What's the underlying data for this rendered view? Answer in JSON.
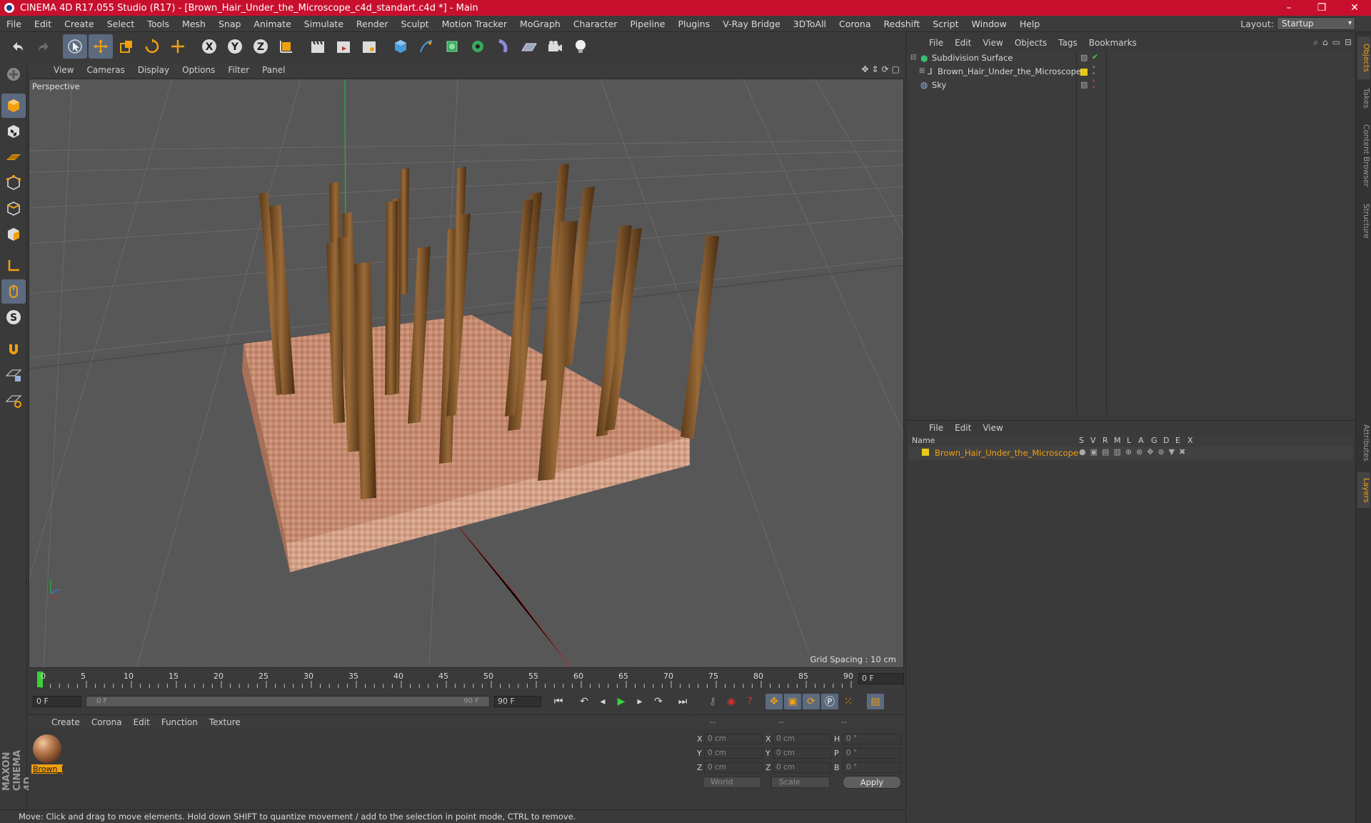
{
  "window": {
    "title": "CINEMA 4D R17.055 Studio (R17) - [Brown_Hair_Under_the_Microscope_c4d_standart.c4d *] - Main",
    "minimize": "–",
    "maximize": "❐",
    "close": "✕"
  },
  "menu": {
    "items": [
      "File",
      "Edit",
      "Create",
      "Select",
      "Tools",
      "Mesh",
      "Snap",
      "Animate",
      "Simulate",
      "Render",
      "Sculpt",
      "Motion Tracker",
      "MoGraph",
      "Character",
      "Pipeline",
      "Plugins",
      "V-Ray Bridge",
      "3DToAll",
      "Corona",
      "Redshift",
      "Script",
      "Window",
      "Help"
    ],
    "layout_label": "Layout:",
    "layout_value": "Startup"
  },
  "viewport": {
    "menu": [
      "View",
      "Cameras",
      "Display",
      "Options",
      "Filter",
      "Panel"
    ],
    "label": "Perspective",
    "grid_spacing": "Grid Spacing : 10 cm"
  },
  "timeline": {
    "ticks": [
      "0",
      "5",
      "10",
      "15",
      "20",
      "25",
      "30",
      "35",
      "40",
      "45",
      "50",
      "55",
      "60",
      "65",
      "70",
      "75",
      "80",
      "85",
      "90"
    ],
    "current_frame": "0 F",
    "start_field": "0 F",
    "slider_start": "0 F",
    "slider_end": "90 F",
    "end_field": "90 F"
  },
  "material_manager": {
    "menu": [
      "Create",
      "Corona",
      "Edit",
      "Function",
      "Texture"
    ],
    "material_name": "Brown_I"
  },
  "coordinates": {
    "header": [
      "--",
      "--",
      "--"
    ],
    "rows": [
      {
        "l1": "X",
        "v1": "0 cm",
        "l2": "X",
        "v2": "0 cm",
        "l3": "H",
        "v3": "0 °"
      },
      {
        "l1": "Y",
        "v1": "0 cm",
        "l2": "Y",
        "v2": "0 cm",
        "l3": "P",
        "v3": "0 °"
      },
      {
        "l1": "Z",
        "v1": "0 cm",
        "l2": "Z",
        "v2": "0 cm",
        "l3": "B",
        "v3": "0 °"
      }
    ],
    "mode_select": "World",
    "scale_select": "Scale",
    "apply": "Apply"
  },
  "status": {
    "text": "Move: Click and drag to move elements. Hold down SHIFT to quantize movement / add to the selection in point mode, CTRL to remove."
  },
  "object_manager": {
    "menu": [
      "File",
      "Edit",
      "View",
      "Objects",
      "Tags",
      "Bookmarks"
    ],
    "objects": [
      {
        "name": "Subdivision Surface"
      },
      {
        "name": "Brown_Hair_Under_the_Microscope"
      },
      {
        "name": "Sky"
      }
    ]
  },
  "layer_manager": {
    "menu": [
      "File",
      "Edit",
      "View"
    ],
    "columns": [
      "Name",
      "S",
      "V",
      "R",
      "M",
      "L",
      "A",
      "G",
      "D",
      "E",
      "X"
    ],
    "layer_name": "Brown_Hair_Under_the_Microscope",
    "layer_color": "#e8c81a"
  },
  "side_tabs": [
    "Objects",
    "Takes",
    "Content Browser",
    "Structure",
    "Attributes",
    "Layers"
  ],
  "colors": {
    "accent": "#f0a010",
    "titlebar": "#c8102e",
    "active_tool": "#5c6a80"
  }
}
